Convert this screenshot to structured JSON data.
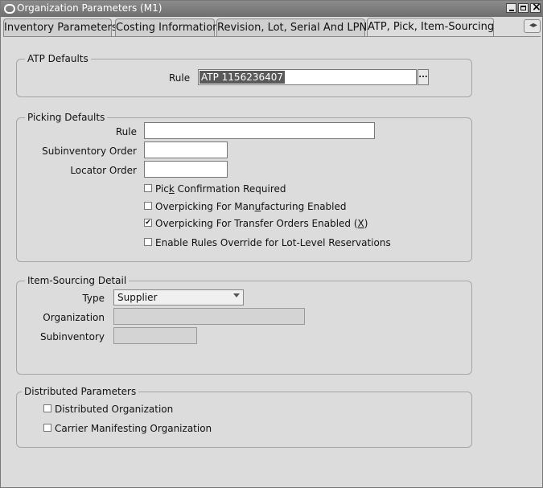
{
  "window": {
    "title": "Organization Parameters (M1)"
  },
  "tabs": [
    {
      "label": "Inventory Parameters"
    },
    {
      "label": "Costing Information"
    },
    {
      "label": "Revision, Lot, Serial And LPN"
    },
    {
      "label": "ATP, Pick, Item-Sourcing"
    }
  ],
  "atp_defaults": {
    "title": "ATP Defaults",
    "rule_label": "Rule",
    "rule_value": "ATP 1156236407",
    "lov_button": "..."
  },
  "picking_defaults": {
    "title": "Picking Defaults",
    "rule_label": "Rule",
    "subinventory_order_label": "Subinventory Order",
    "locator_order_label": "Locator Order",
    "checkboxes": [
      {
        "label_pre": "Pic",
        "label_accel": "k",
        "label_post": " Confirmation Required",
        "checked": false
      },
      {
        "label_pre": "Overpicking For Man",
        "label_accel": "u",
        "label_post": "facturing Enabled",
        "checked": false
      },
      {
        "label_pre": "Overpicking For Transfer Orders Enabled (",
        "label_accel": "X",
        "label_post": ")",
        "checked": true
      },
      {
        "label_pre": "Enable Rules Override for Lot-Level Reservations",
        "label_accel": "",
        "label_post": "",
        "checked": false
      }
    ]
  },
  "item_sourcing": {
    "title": "Item-Sourcing Detail",
    "type_label": "Type",
    "type_value": "Supplier",
    "organization_label": "Organization",
    "subinventory_label": "Subinventory"
  },
  "distributed": {
    "title": "Distributed Parameters",
    "checkboxes": [
      {
        "label": "Distributed Organization",
        "checked": false
      },
      {
        "label": "Carrier Manifesting Organization",
        "checked": false
      }
    ]
  },
  "check_mark": "✔"
}
